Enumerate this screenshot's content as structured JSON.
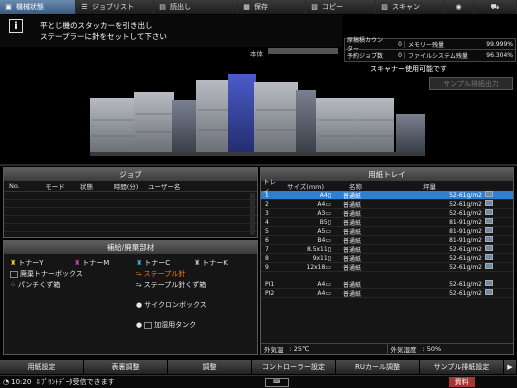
{
  "tabs": [
    {
      "label": "機械状態",
      "icon": "machine-icon"
    },
    {
      "label": "ジョブリスト",
      "icon": "list-icon"
    },
    {
      "label": "読出し",
      "icon": "document-icon"
    },
    {
      "label": "保存",
      "icon": "save-icon"
    },
    {
      "label": "コピー",
      "icon": "copy-icon"
    },
    {
      "label": "スキャン",
      "icon": "scan-icon"
    },
    {
      "label": "",
      "icon": "disc-icon"
    },
    {
      "label": "",
      "icon": "cart-icon"
    }
  ],
  "message": {
    "line1": "平とじ機のスタッカーを引き出し",
    "line2": "ステープラーに針をセットして下さい"
  },
  "counter_label": "本体",
  "status": {
    "r1": {
      "k1": "原稿積カウンター",
      "v1": "0",
      "k2": "メモリー残量",
      "v2": "99.999%"
    },
    "r2": {
      "k1": "予約ジョブ数",
      "v1": "0",
      "k2": "ファイルシステム残量",
      "v2": "96.304%"
    }
  },
  "scanner_status": "スキャナー使用可能です",
  "sample_button": "サンプル排紙出力",
  "job": {
    "title": "ジョブ",
    "columns": [
      "No.",
      "モード",
      "状態",
      "時間(分)",
      "ユーザー名"
    ]
  },
  "supply": {
    "title": "補給/廃棄部材",
    "items": {
      "ty": "トナーY",
      "tm": "トナーM",
      "tc": "トナーC",
      "tk": "トナーK",
      "waste": "廃棄トナーボックス",
      "staple": "ステープル針",
      "punch": "パンチくず箱",
      "staple_waste": "ステープル針くず箱",
      "cyclone": "サイクロンボックス",
      "humid": "加湿用タンク"
    }
  },
  "paper": {
    "title": "用紙トレイ",
    "columns": [
      "トレイ",
      "サイズ(mm)",
      "名称",
      "坪量"
    ],
    "rows": [
      {
        "tray": "1",
        "size": "A4▯",
        "name": "普通紙",
        "weight": "52-61g/m2"
      },
      {
        "tray": "2",
        "size": "A4▭",
        "name": "普通紙",
        "weight": "52-61g/m2"
      },
      {
        "tray": "3",
        "size": "A3▭",
        "name": "普通紙",
        "weight": "52-61g/m2"
      },
      {
        "tray": "4",
        "size": "B5▯",
        "name": "普通紙",
        "weight": "81-91g/m2"
      },
      {
        "tray": "5",
        "size": "A5▭",
        "name": "普通紙",
        "weight": "81-91g/m2"
      },
      {
        "tray": "6",
        "size": "B4▭",
        "name": "普通紙",
        "weight": "81-91g/m2"
      },
      {
        "tray": "7",
        "size": "8.5x11▯",
        "name": "普通紙",
        "weight": "52-61g/m2"
      },
      {
        "tray": "8",
        "size": "9x11▯",
        "name": "普通紙",
        "weight": "52-61g/m2"
      },
      {
        "tray": "9",
        "size": "12x18▭",
        "name": "普通紙",
        "weight": "52-61g/m2"
      },
      {
        "tray": "PI1",
        "size": "A4▭",
        "name": "普通紙",
        "weight": "52-61g/m2"
      },
      {
        "tray": "PI2",
        "size": "A4▭",
        "name": "普通紙",
        "weight": "52-61g/m2"
      }
    ],
    "outside_temp_label": "外気温",
    "outside_temp": ":    25℃",
    "outside_humid_label": "外気湿度",
    "outside_humid": ":     50%"
  },
  "bottom": [
    "用紙設定",
    "表裏調整",
    "調整",
    "コントローラー設定",
    "RUカール調整",
    "サンプル排紙設定"
  ],
  "statusbar": {
    "time": "10:20",
    "message": "ﾌﾟﾘﾝﾄﾃﾞｰﾀ受信できます",
    "badge": "資料"
  },
  "colors": {
    "accent": "#2f7fd0",
    "tab_active": "#4f6f98",
    "toner_y": "#e8d020",
    "toner_m": "#d040a0",
    "toner_c": "#30b0e0",
    "toner_k": "#303030",
    "warn": "#ff7a00"
  }
}
